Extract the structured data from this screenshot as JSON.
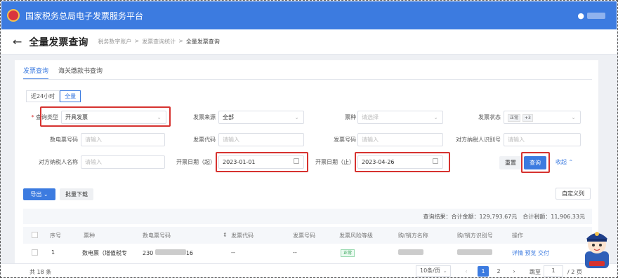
{
  "app": {
    "title": "国家税务总局电子发票服务平台",
    "user_icon": "person-icon"
  },
  "page": {
    "title": "全量发票查询",
    "breadcrumb": [
      "税务数字账户",
      "发票查询统计",
      "全量发票查询"
    ]
  },
  "tabs": [
    "发票查询",
    "海关缴款书查询"
  ],
  "range_buttons": [
    "近24小时",
    "全量"
  ],
  "filters": {
    "query_type": {
      "label": "查询类型",
      "value": "开具发票"
    },
    "source": {
      "label": "发票来源",
      "value": "全部"
    },
    "kind": {
      "label": "票种",
      "placeholder": "请选择"
    },
    "status": {
      "label": "发票状态",
      "tags": [
        "正常",
        "+3"
      ]
    },
    "einvoice_no": {
      "label": "数电票号码",
      "placeholder": "请输入"
    },
    "invoice_code": {
      "label": "发票代码",
      "placeholder": "请输入"
    },
    "invoice_no": {
      "label": "发票号码",
      "placeholder": "请输入"
    },
    "tax_id": {
      "label": "对方纳税人识别号",
      "placeholder": "请输入"
    },
    "tax_name": {
      "label": "对方纳税人名称",
      "placeholder": "请输入"
    },
    "date_start": {
      "label": "开票日期（起）",
      "value": "2023-01-01"
    },
    "date_end": {
      "label": "开票日期（止）",
      "value": "2023-04-26"
    }
  },
  "actions": {
    "reset": "重置",
    "search": "查询",
    "collapse": "收起 ⌃",
    "export": "导出 ⌄",
    "batch": "批量下载",
    "custom": "自定义列"
  },
  "summary": "查询结果：合计金额：129,793.67元　合计税额：11,906.33元",
  "table": {
    "headers": [
      "序号",
      "票种",
      "数电票号码",
      "发票代码",
      "发票号码",
      "发票风险等级",
      "购/销方名称",
      "购/销方识别号",
      "操作"
    ],
    "row": {
      "index": "1",
      "kind": "数电票（增值税专",
      "number_prefix": "230",
      "number_suffix": "16",
      "code": "--",
      "no": "--",
      "risk": "正常",
      "actions": [
        "详情",
        "预览",
        "交付"
      ]
    }
  },
  "pagination": {
    "total": "共 18 条",
    "page_size": "10条/页",
    "pages": [
      "1",
      "2"
    ],
    "prev": "‹",
    "next": "›",
    "jump_label": "跳至",
    "jump_value": "1",
    "page_count": "/ 2 页"
  }
}
